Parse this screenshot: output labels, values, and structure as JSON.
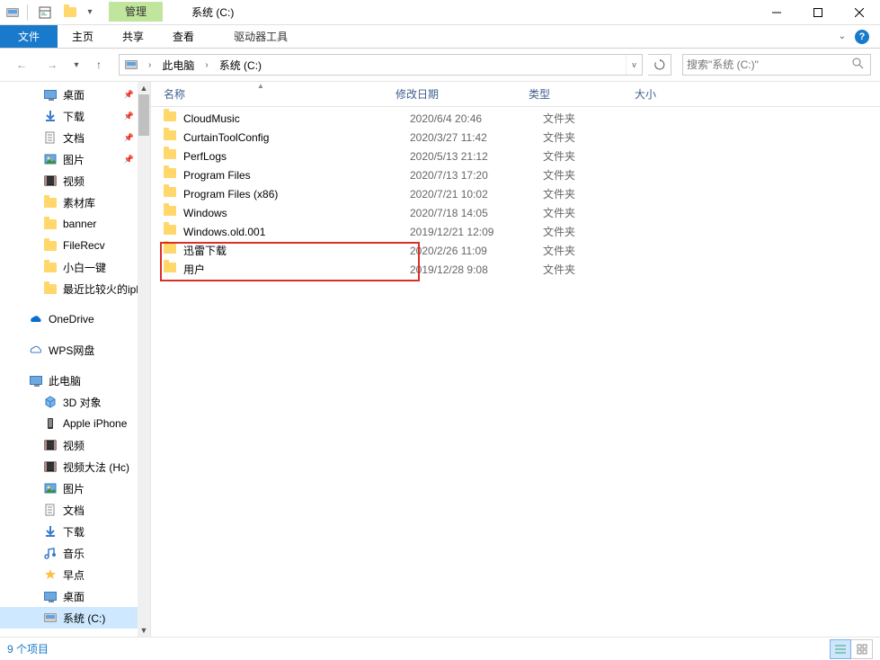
{
  "titlebar": {
    "context_label": "管理",
    "context_tab": "驱动器工具",
    "title": "系统 (C:)"
  },
  "ribbon": {
    "file": "文件",
    "home": "主页",
    "share": "共享",
    "view": "查看",
    "drive_tools": "驱动器工具"
  },
  "address": {
    "root": "此电脑",
    "current": "系统 (C:)"
  },
  "search": {
    "placeholder": "搜索\"系统 (C:)\""
  },
  "columns": {
    "name": "名称",
    "modified": "修改日期",
    "type": "类型",
    "size": "大小"
  },
  "tree": {
    "quick": [
      {
        "label": "桌面",
        "icon": "desktop",
        "pinned": true
      },
      {
        "label": "下载",
        "icon": "download",
        "pinned": true
      },
      {
        "label": "文档",
        "icon": "doc",
        "pinned": true
      },
      {
        "label": "图片",
        "icon": "pic",
        "pinned": true
      },
      {
        "label": "视频",
        "icon": "video",
        "pinned": false
      },
      {
        "label": "素材库",
        "icon": "folder",
        "pinned": false
      },
      {
        "label": "banner",
        "icon": "folder",
        "pinned": false
      },
      {
        "label": "FileRecv",
        "icon": "folder",
        "pinned": false
      },
      {
        "label": "小白一键",
        "icon": "folder",
        "pinned": false
      },
      {
        "label": "最近比较火的ipl",
        "icon": "folder",
        "pinned": false
      }
    ],
    "onedrive": "OneDrive",
    "wps": "WPS网盘",
    "thispc": "此电脑",
    "pc_children": [
      {
        "label": "3D 对象",
        "icon": "3d"
      },
      {
        "label": "Apple iPhone",
        "icon": "phone"
      },
      {
        "label": "视频",
        "icon": "video"
      },
      {
        "label": "视频大法 (Hc)",
        "icon": "video2"
      },
      {
        "label": "图片",
        "icon": "pic"
      },
      {
        "label": "文档",
        "icon": "doc"
      },
      {
        "label": "下载",
        "icon": "download"
      },
      {
        "label": "音乐",
        "icon": "music"
      },
      {
        "label": "早点",
        "icon": "star"
      },
      {
        "label": "桌面",
        "icon": "desktop"
      },
      {
        "label": "系统 (C:)",
        "icon": "drive",
        "selected": true
      }
    ]
  },
  "files": [
    {
      "name": "CloudMusic",
      "mod": "2020/6/4 20:46",
      "type": "文件夹"
    },
    {
      "name": "CurtainToolConfig",
      "mod": "2020/3/27 11:42",
      "type": "文件夹"
    },
    {
      "name": "PerfLogs",
      "mod": "2020/5/13 21:12",
      "type": "文件夹"
    },
    {
      "name": "Program Files",
      "mod": "2020/7/13 17:20",
      "type": "文件夹"
    },
    {
      "name": "Program Files (x86)",
      "mod": "2020/7/21 10:02",
      "type": "文件夹"
    },
    {
      "name": "Windows",
      "mod": "2020/7/18 14:05",
      "type": "文件夹"
    },
    {
      "name": "Windows.old.001",
      "mod": "2019/12/21 12:09",
      "type": "文件夹"
    },
    {
      "name": "迅雷下载",
      "mod": "2020/2/26 11:09",
      "type": "文件夹"
    },
    {
      "name": "用户",
      "mod": "2019/12/28 9:08",
      "type": "文件夹"
    }
  ],
  "status": {
    "count": "9 个项目"
  }
}
